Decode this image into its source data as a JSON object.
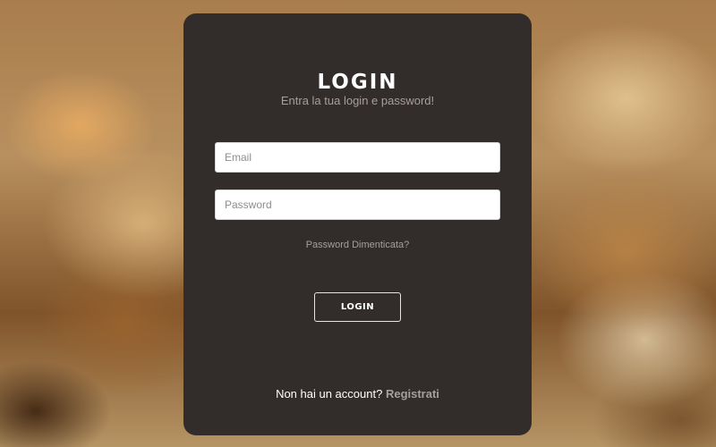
{
  "colors": {
    "card_background": "#322c2b",
    "muted_text": "#a59f9d",
    "primary_text": "#ffffff",
    "input_background": "#ffffff"
  },
  "login": {
    "title": "LOGIN",
    "subtitle": "Entra la tua login e password!",
    "email_placeholder": "Email",
    "email_value": "",
    "password_placeholder": "Password",
    "password_value": "",
    "forgot_link": "Password Dimenticata?",
    "submit_label": "LOGIN"
  },
  "signup": {
    "prompt": "Non hai un account?",
    "link": "Registrati"
  }
}
